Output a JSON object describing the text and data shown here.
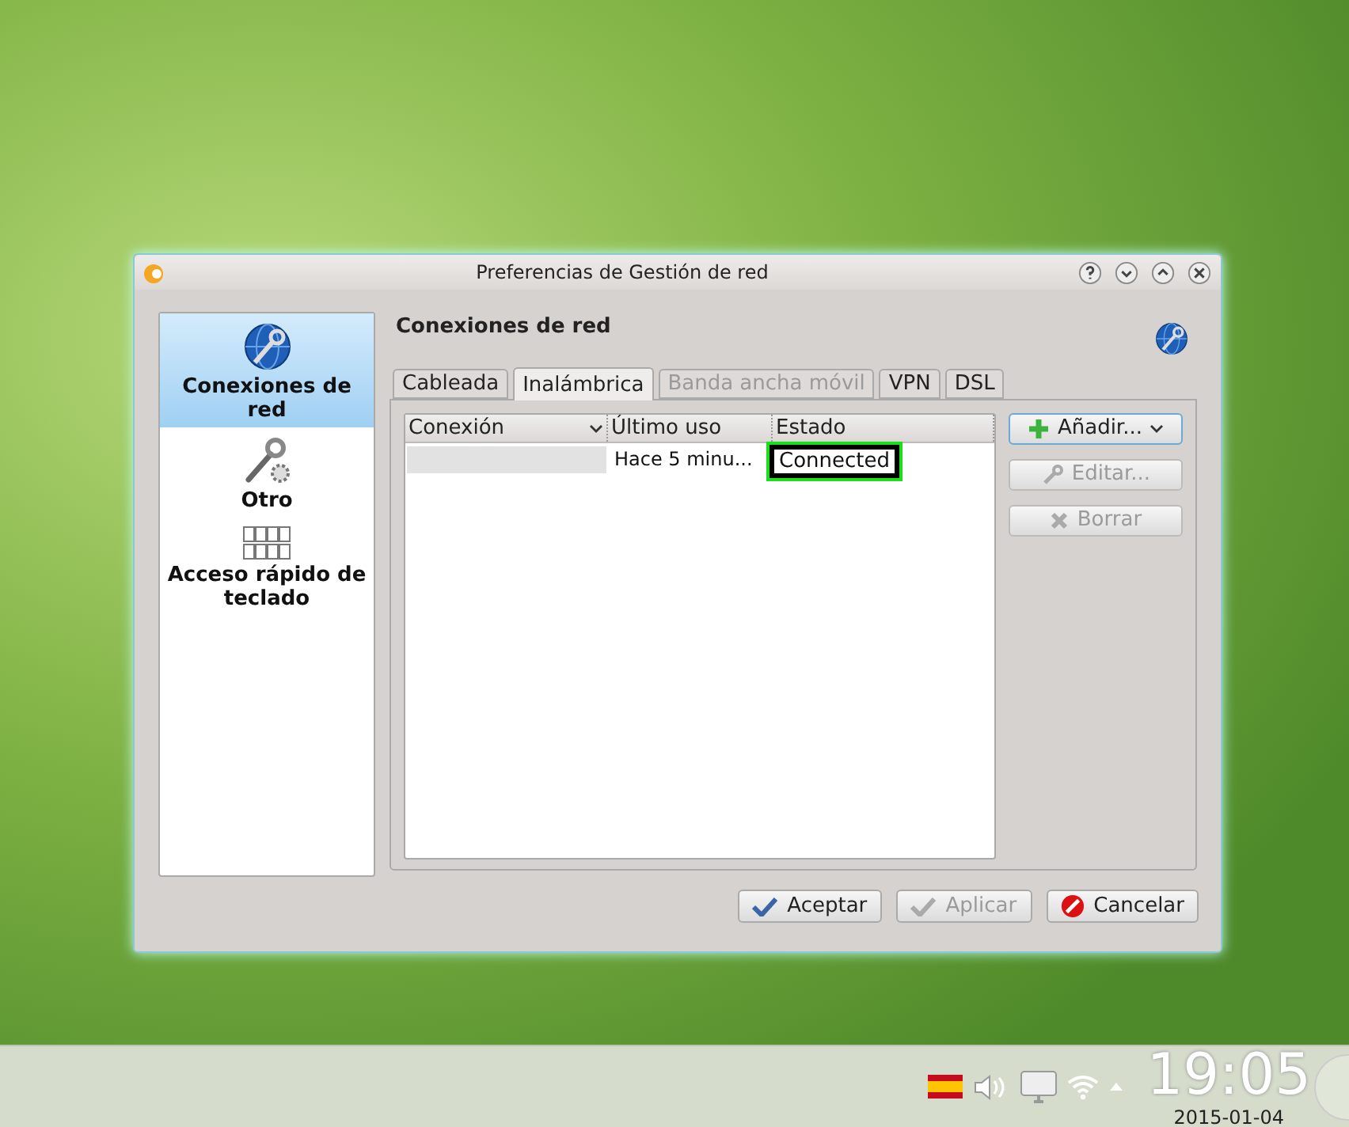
{
  "window": {
    "title": "Preferencias de Gestión de red"
  },
  "sidebar": {
    "items": [
      {
        "label": "Conexiones de red",
        "selected": true,
        "kind": "globe"
      },
      {
        "label": "Otro",
        "selected": false,
        "kind": "wrench"
      },
      {
        "label": "Acceso rápido de teclado",
        "selected": false,
        "kind": "keyboard"
      }
    ]
  },
  "heading": "Conexiones de red",
  "tabs": [
    {
      "label": "Cableada",
      "selected": false,
      "disabled": false
    },
    {
      "label": "Inalámbrica",
      "selected": true,
      "disabled": false
    },
    {
      "label": "Banda ancha móvil",
      "selected": false,
      "disabled": true
    },
    {
      "label": "VPN",
      "selected": false,
      "disabled": false
    },
    {
      "label": "DSL",
      "selected": false,
      "disabled": false
    }
  ],
  "table": {
    "columns": [
      "Conexión",
      "Último uso",
      "Estado"
    ],
    "rows": [
      {
        "last_used": "Hace 5 minu...",
        "status": "Connected",
        "highlighted": true
      }
    ]
  },
  "side_buttons": [
    {
      "label": "Añadir...",
      "kind": "add",
      "disabled": false
    },
    {
      "label": "Editar...",
      "kind": "edit",
      "disabled": true
    },
    {
      "label": "Borrar",
      "kind": "delete",
      "disabled": true
    }
  ],
  "dialog_buttons": [
    {
      "label": "Aceptar",
      "kind": "ok",
      "disabled": false
    },
    {
      "label": "Aplicar",
      "kind": "apply",
      "disabled": true
    },
    {
      "label": "Cancelar",
      "kind": "cancel",
      "disabled": false
    }
  ],
  "taskbar": {
    "time": "19:05",
    "date": "2015-01-04"
  }
}
